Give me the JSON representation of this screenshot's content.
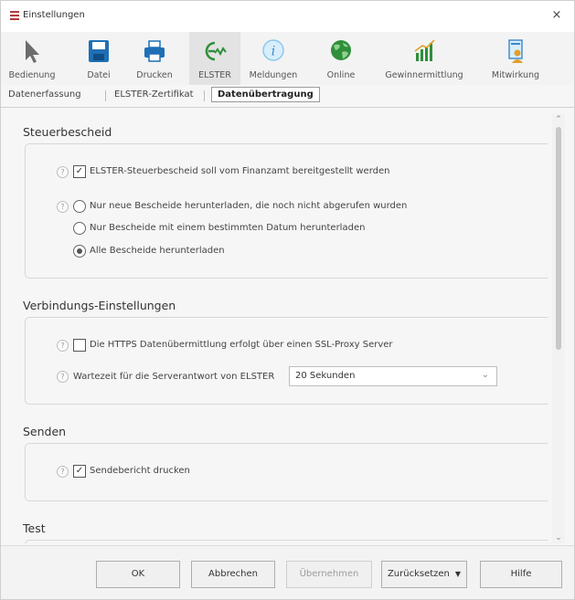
{
  "window": {
    "title": "Einstellungen",
    "close": "×"
  },
  "toolbar": {
    "items": [
      {
        "label": "Bedienung",
        "icon": "cursor-icon"
      },
      {
        "label": "Datei",
        "icon": "save-icon"
      },
      {
        "label": "Drucken",
        "icon": "printer-icon"
      },
      {
        "label": "ELSTER",
        "icon": "elster-icon"
      },
      {
        "label": "Meldungen",
        "icon": "info-icon"
      },
      {
        "label": "Online",
        "icon": "globe-icon"
      },
      {
        "label": "Gewinnermittlung",
        "icon": "bar-chart-icon"
      },
      {
        "label": "Mitwirkung",
        "icon": "user-document-icon"
      }
    ],
    "active_index": 3
  },
  "subtabs": {
    "items": [
      "Datenerfassung",
      "ELSTER-Zertifikat",
      "Datenübertragung"
    ],
    "active_index": 2
  },
  "sections": {
    "steuerbescheid": {
      "title": "Steuerbescheid",
      "checkbox_label": "ELSTER-Steuerbescheid soll vom Finanzamt bereitgestellt werden",
      "checkbox_checked": true,
      "radio_options": [
        "Nur neue Bescheide herunterladen, die noch nicht abgerufen wurden",
        "Nur Bescheide mit einem bestimmten Datum herunterladen",
        "Alle Bescheide herunterladen"
      ],
      "radio_selected_index": 2
    },
    "verbindung": {
      "title": "Verbindungs-Einstellungen",
      "checkbox_label": "Die HTTPS Datenübermittlung erfolgt über einen SSL-Proxy Server",
      "checkbox_checked": false,
      "wait_label": "Wartezeit für die Serverantwort von ELSTER",
      "wait_value": "20 Sekunden"
    },
    "senden": {
      "title": "Senden",
      "checkbox_label": "Sendebericht drucken",
      "checkbox_checked": true
    },
    "test": {
      "title": "Test"
    }
  },
  "help_glyph": "?",
  "check_glyph": "✓",
  "footer": {
    "ok": "OK",
    "cancel": "Abbrechen",
    "apply": "Übernehmen",
    "reset": "Zurücksetzen",
    "help": "Hilfe"
  },
  "colors": {
    "elster_green": "#2f8f3a",
    "save_blue": "#1f6fb5",
    "window_bg": "#f6f6f6"
  }
}
